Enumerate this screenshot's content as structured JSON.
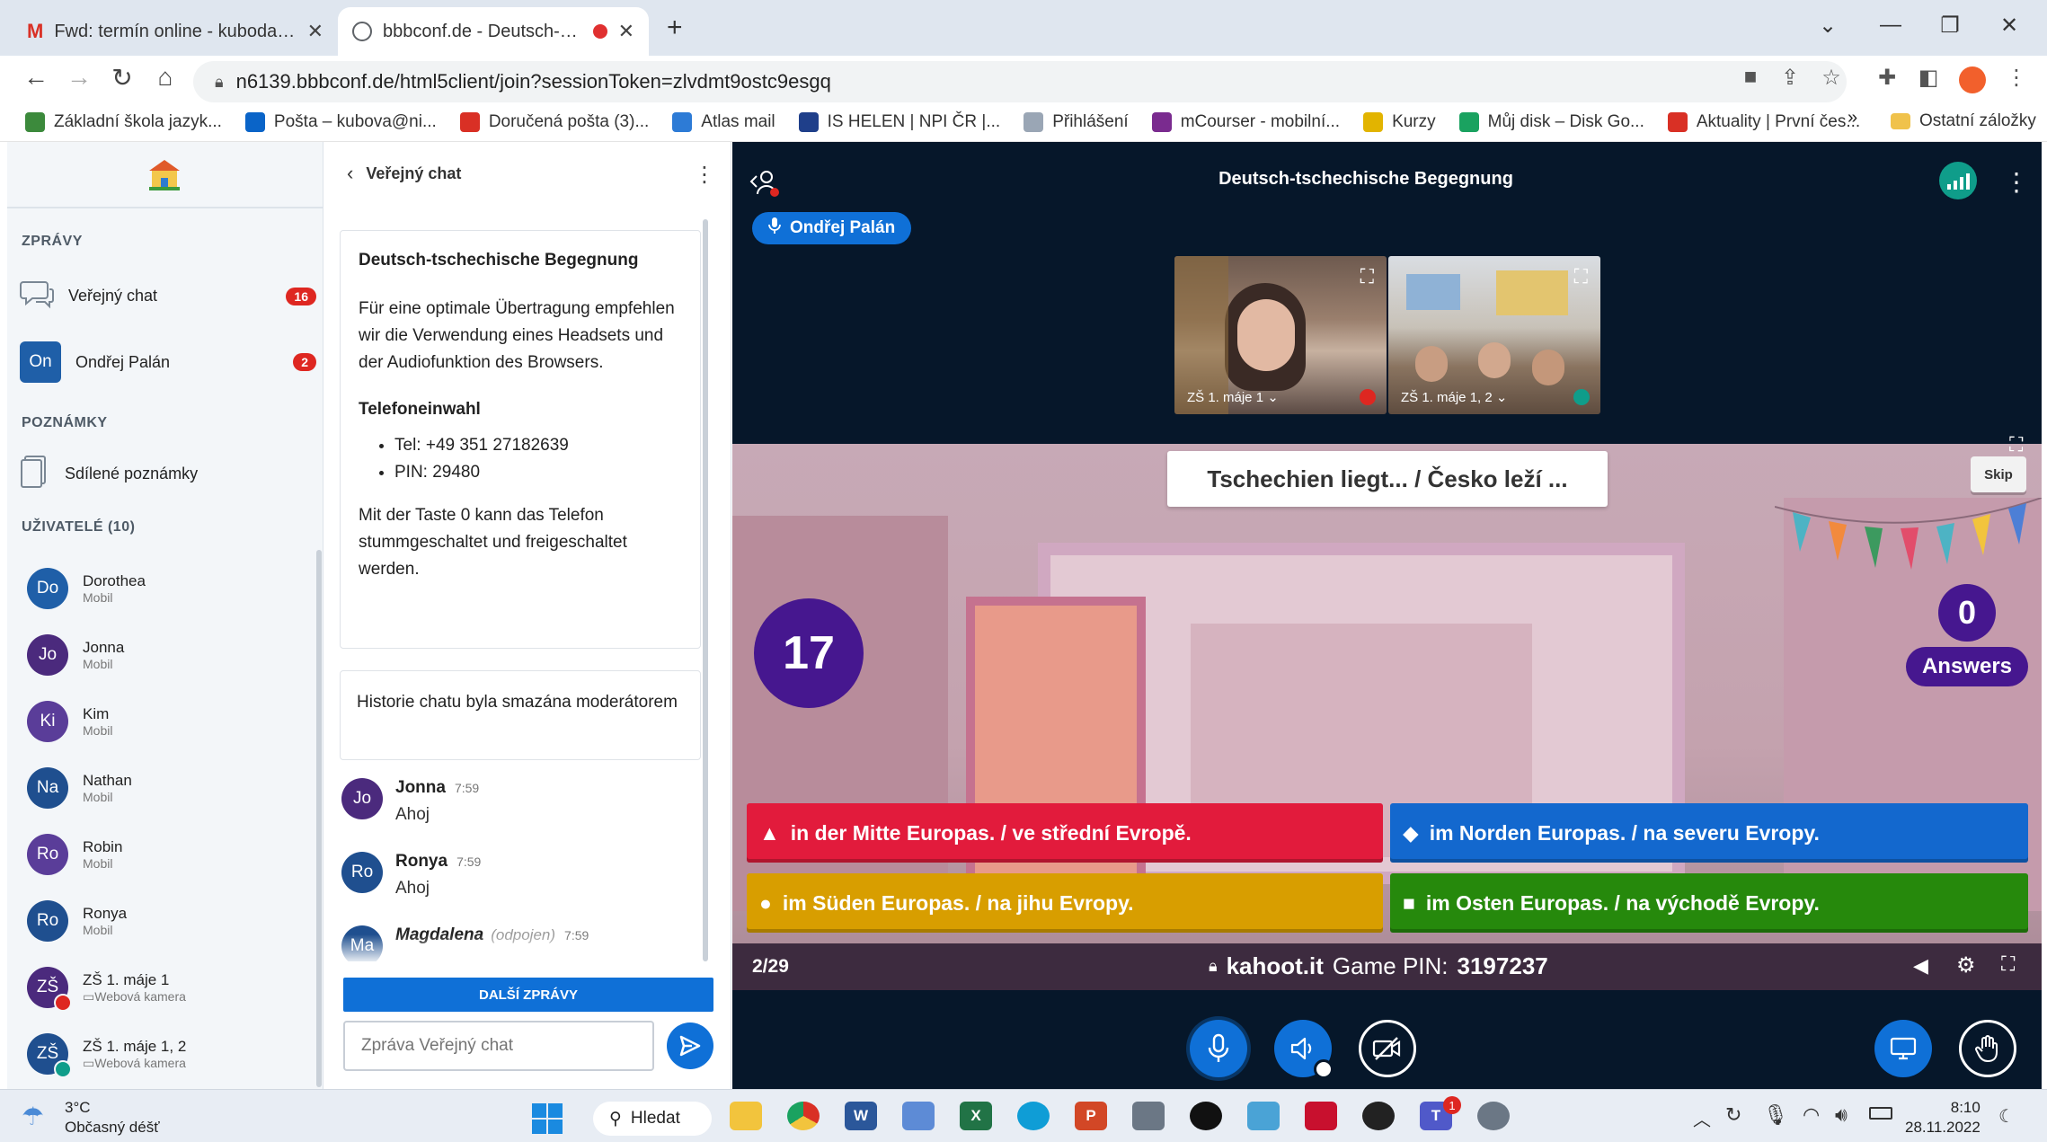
{
  "browser": {
    "tabs": [
      {
        "title": "Fwd: termín online - kuboda8@g",
        "favicon_color": "#d93025"
      },
      {
        "title": "bbbconf.de - Deutsch-tschec",
        "favicon_color": "#5f6368"
      }
    ],
    "url": "n6139.bbbconf.de/html5client/join?sessionToken=zlvdmt9ostc9esgq",
    "bookmarks": [
      {
        "label": "Základní škola jazyk...",
        "color": "#3c8a3c"
      },
      {
        "label": "Pošta – kubova@ni...",
        "color": "#0a64c8"
      },
      {
        "label": "Doručená pošta (3)...",
        "color": "#d93025"
      },
      {
        "label": "Atlas mail",
        "color": "#2d7bd6"
      },
      {
        "label": "IS HELEN | NPI ČR |...",
        "color": "#1f3f8a"
      },
      {
        "label": "Přihlášení",
        "color": "#9aa6b5"
      },
      {
        "label": "mCourser - mobilní...",
        "color": "#7a2b8f"
      },
      {
        "label": "Kurzy",
        "color": "#e2b400"
      },
      {
        "label": "Můj disk – Disk Go...",
        "color": "#1aa260"
      },
      {
        "label": "Aktuality | První čes...",
        "color": "#d93025"
      }
    ],
    "more_bookmarks": "»",
    "other_bookmarks": "Ostatní záložky"
  },
  "sidebar": {
    "messages_title": "ZPRÁVY",
    "items": [
      {
        "label": "Veřejný chat",
        "badge": "16"
      },
      {
        "label": "Ondřej Palán",
        "badge": "2",
        "initials": "On"
      }
    ],
    "notes_title": "POZNÁMKY",
    "notes_item": "Sdílené poznámky",
    "users_title": "UŽIVATELÉ (10)",
    "users": [
      {
        "initials": "Do",
        "name": "Dorothea",
        "status": "Mobil",
        "color": "#1f5fa8"
      },
      {
        "initials": "Jo",
        "name": "Jonna",
        "status": "Mobil",
        "color": "#4b2a7d"
      },
      {
        "initials": "Ki",
        "name": "Kim",
        "status": "Mobil",
        "color": "#5a3d99"
      },
      {
        "initials": "Na",
        "name": "Nathan",
        "status": "Mobil",
        "color": "#1f4f8f"
      },
      {
        "initials": "Ro",
        "name": "Robin",
        "status": "Mobil",
        "color": "#5a3d99"
      },
      {
        "initials": "Ro",
        "name": "Ronya",
        "status": "Mobil",
        "color": "#1f4f8f"
      },
      {
        "initials": "ZŠ",
        "name": "ZŠ 1. máje 1",
        "status": "Webová kamera",
        "color": "#4b2a7d"
      },
      {
        "initials": "ZŠ",
        "name": "ZŠ 1. máje 1, 2",
        "status": "Webová kamera",
        "color": "#1f4f8f"
      }
    ]
  },
  "chat": {
    "header": "Veřejný chat",
    "welcome_title": "Deutsch-tschechische Begegnung",
    "welcome_text": "Für eine optimale Übertragung empfehlen wir die Verwendung eines Headsets und der Audiofunktion des Browsers.",
    "phone_title": "Telefoneinwahl",
    "phone_tel": "Tel: +49 351 27182639",
    "phone_pin": "PIN: 29480",
    "phone_note": "Mit der Taste 0 kann das Telefon stummgeschaltet und freigeschaltet werden.",
    "cleared_notice": "Historie chatu byla smazána moderátorem",
    "messages": [
      {
        "initials": "Jo",
        "name": "Jonna",
        "time": "7:59",
        "text": "Ahoj",
        "color": "#4b2a7d"
      },
      {
        "initials": "Ro",
        "name": "Ronya",
        "time": "7:59",
        "text": "Ahoj",
        "color": "#1f4f8f"
      },
      {
        "initials": "Ma",
        "name": "Magdalena",
        "tag": "(odpojen)",
        "time": "7:59",
        "color": "#1f4f8f"
      }
    ],
    "more_button": "DALŠÍ ZPRÁVY",
    "input_placeholder": "Zpráva Veřejný chat"
  },
  "meeting": {
    "title": "Deutsch-tschechische Begegnung",
    "talking": "Ondřej Palán",
    "webcams": [
      {
        "label": "ZŠ 1. máje 1 ⌄"
      },
      {
        "label": "ZŠ 1. máje 1, 2 ⌄"
      }
    ]
  },
  "kahoot": {
    "question": "Tschechien liegt... / Česko leží ...",
    "timer": "17",
    "answers_count": "0",
    "answers_label": "Answers",
    "skip_label": "Skip",
    "options": [
      {
        "shape": "▲",
        "text": "in der Mitte Europas. / ve střední Evropě.",
        "color": "#e21b3c"
      },
      {
        "shape": "◆",
        "text": "im Norden Europas. / na severu Evropy.",
        "color": "#1368ce"
      },
      {
        "shape": "●",
        "text": "im Süden Europas. / na jihu Evropy.",
        "color": "#d89e00"
      },
      {
        "shape": "■",
        "text": "im Osten Europas. / na východě Evropy.",
        "color": "#26890c"
      }
    ],
    "progress": "2/29",
    "site": "kahoot.it",
    "pin_label": "Game PIN:",
    "pin_value": "3197237"
  },
  "taskbar": {
    "temperature": "3°C",
    "weather": "Občasný déšť",
    "search": "Hledat",
    "time": "8:10",
    "date": "28.11.2022",
    "teams_badge": "1"
  }
}
